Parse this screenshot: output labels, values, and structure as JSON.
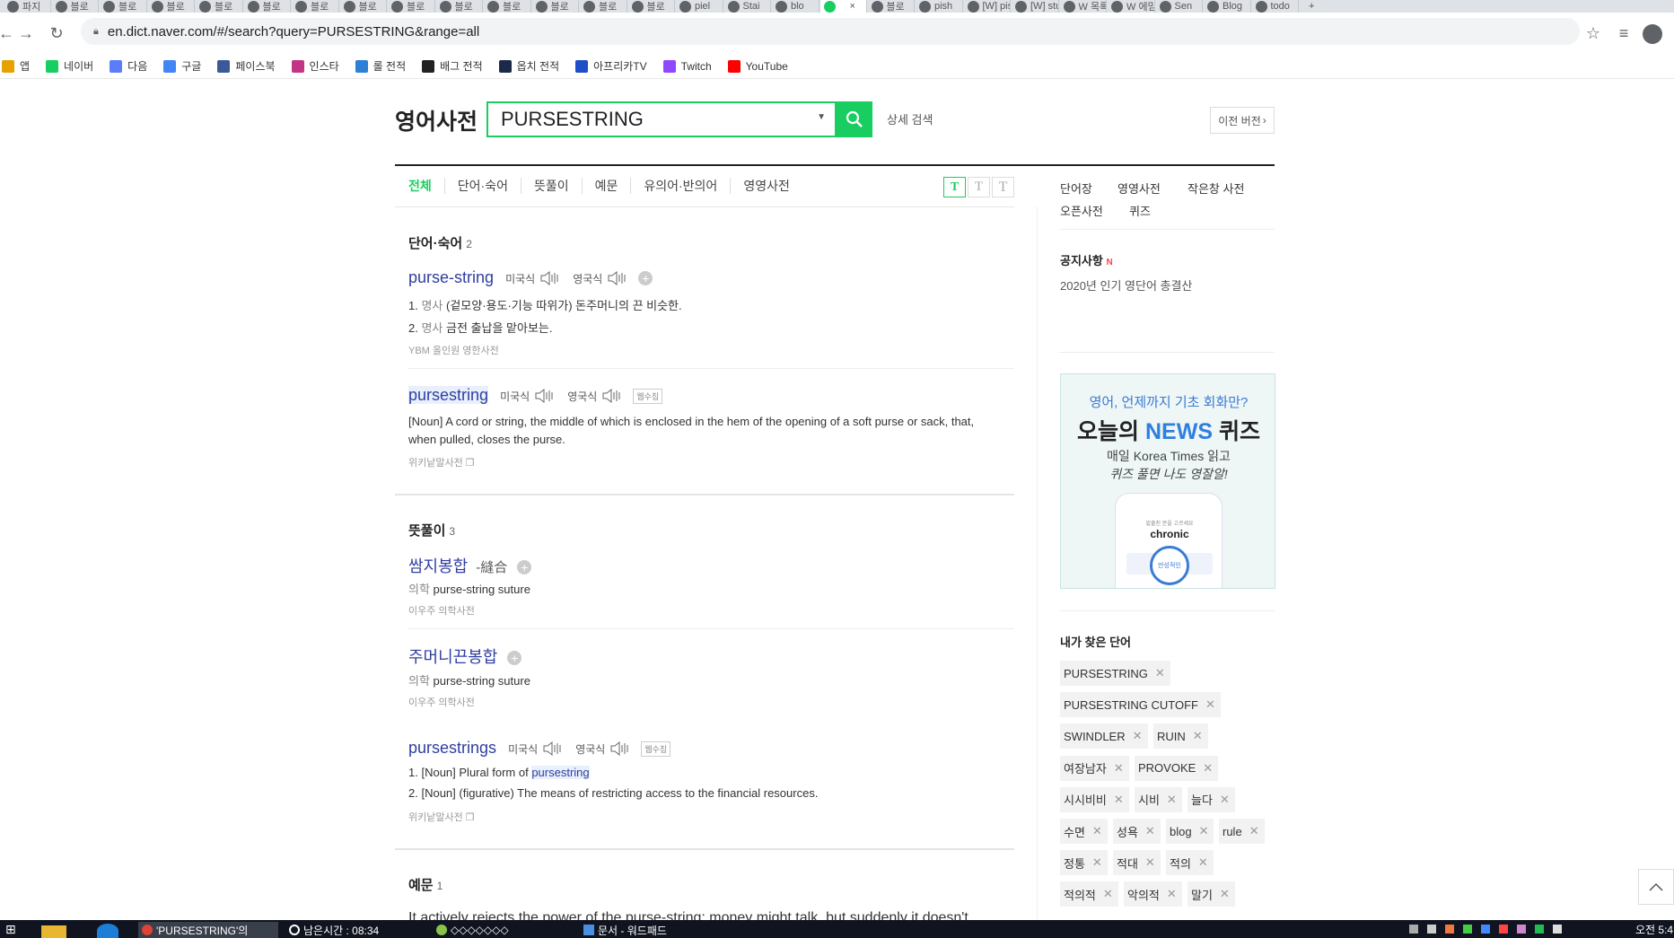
{
  "browser": {
    "tabs": [
      {
        "title": "파지",
        "active": false
      },
      {
        "title": "블로",
        "active": false
      },
      {
        "title": "블로",
        "active": false
      },
      {
        "title": "블로",
        "active": false
      },
      {
        "title": "블로",
        "active": false
      },
      {
        "title": "블로",
        "active": false
      },
      {
        "title": "블로",
        "active": false
      },
      {
        "title": "블로",
        "active": false
      },
      {
        "title": "블로",
        "active": false
      },
      {
        "title": "블로",
        "active": false
      },
      {
        "title": "블로",
        "active": false
      },
      {
        "title": "블로",
        "active": false
      },
      {
        "title": "블로",
        "active": false
      },
      {
        "title": "블로",
        "active": false
      },
      {
        "title": "piel",
        "active": false
      },
      {
        "title": "Stai",
        "active": false
      },
      {
        "title": "blo",
        "active": false
      },
      {
        "title": "",
        "active": true
      },
      {
        "title": "블로",
        "active": false
      },
      {
        "title": "pish",
        "active": false
      },
      {
        "title": "[W] pish",
        "active": false
      },
      {
        "title": "[W] stuc",
        "active": false
      },
      {
        "title": "W 목록",
        "active": false
      },
      {
        "title": "W 에믿",
        "active": false
      },
      {
        "title": "Sen",
        "active": false
      },
      {
        "title": "Blog",
        "active": false
      },
      {
        "title": "todo",
        "active": false
      }
    ],
    "url": "en.dict.naver.com/#/search?query=PURSESTRING&range=all",
    "bookmarks": [
      {
        "label": "앱",
        "color": "#e5a200"
      },
      {
        "label": "네이버",
        "color": "#19ce60"
      },
      {
        "label": "다음",
        "color": "#5b7dfa"
      },
      {
        "label": "구글",
        "color": "#4285f4"
      },
      {
        "label": "페이스북",
        "color": "#3b5998"
      },
      {
        "label": "인스타",
        "color": "#c13584"
      },
      {
        "label": "롤 전적",
        "color": "#2e7fd6"
      },
      {
        "label": "배그 전적",
        "color": "#222222"
      },
      {
        "label": "옵치 전적",
        "color": "#1b2a4a"
      },
      {
        "label": "아프리카TV",
        "color": "#1e4fc7"
      },
      {
        "label": "Twitch",
        "color": "#9146ff"
      },
      {
        "label": "YouTube",
        "color": "#ff0000"
      }
    ]
  },
  "dict": {
    "logo": "영어사전",
    "query": "PURSESTRING",
    "advanced": "상세 검색",
    "prev_version": "이전 버전",
    "tabs": [
      "전체",
      "단어·숙어",
      "뜻풀이",
      "예문",
      "유의어·반의어",
      "영영사전"
    ],
    "font_buttons": [
      "T",
      "T",
      "T"
    ],
    "words": {
      "heading": "단어·숙어",
      "count": "2",
      "items": [
        {
          "word": "purse-string",
          "us": "미국식",
          "uk": "영국식",
          "defs": [
            {
              "num": "1.",
              "pos": "명사",
              "text": "(겉모양·용도·기능 따위가) 돈주머니의 끈 비슷한."
            },
            {
              "num": "2.",
              "pos": "명사",
              "text": "금전 출납을 맡아보는."
            }
          ],
          "source": "YBM 올인원 영한사전"
        },
        {
          "word": "pursestring",
          "us": "미국식",
          "uk": "영국식",
          "badge": "웹수집",
          "def": "[Noun] A cord or string, the middle of which is enclosed in the hem of the opening of a soft purse or sack, that, when pulled, closes the purse.",
          "source": "위키낱말사전"
        }
      ]
    },
    "meanings": {
      "heading": "뜻풀이",
      "count": "3",
      "items": [
        {
          "word": "쌈지봉합",
          "hanja": "-縫合",
          "field": "의학",
          "text": "purse-string suture",
          "source": "이우주 의학사전"
        },
        {
          "word": "주머니끈봉합",
          "field": "의학",
          "text": "purse-string suture",
          "source": "이우주 의학사전"
        },
        {
          "word": "pursestrings",
          "us": "미국식",
          "uk": "영국식",
          "badge": "웹수집",
          "def1_num": "1.",
          "def1_text": "[Noun] Plural form of",
          "def1_link": "pursestring",
          "def2_num": "2.",
          "def2_text": "[Noun] (figurative) The means of restricting access to the financial resources.",
          "source": "위키낱말사전"
        }
      ]
    },
    "examples": {
      "heading": "예문",
      "count": "1",
      "first": "It actively rejects the power of the purse-string; money might talk, but suddenly it doesn't"
    }
  },
  "sidebar": {
    "links": [
      "단어장",
      "영영사전",
      "작은창 사전",
      "오픈사전",
      "퀴즈"
    ],
    "notice_title": "공지사항",
    "notice_new": "N",
    "notice_text": "2020년 인기 영단어 총결산",
    "banner": {
      "line1": "영어, 언제까지 기초 회화만?",
      "line2a": "오늘의",
      "line2b": "NEWS",
      "line2c": "퀴즈",
      "line3": "매일 Korea Times 읽고",
      "line4": "퀴즈 풀면 나도 영잘알!",
      "phone_small": "밑줄친 문을 고르세요",
      "phone_word": "chronic",
      "phone_answer": "만성적인"
    },
    "history_title": "내가 찾은 단어",
    "history": [
      [
        "PURSESTRING"
      ],
      [
        "PURSESTRING CUTOFF"
      ],
      [
        "SWINDLER",
        "RUIN"
      ],
      [
        "여장남자",
        "PROVOKE"
      ],
      [
        "시시비비",
        "시비",
        "늘다"
      ],
      [
        "수면",
        "성욕",
        "blog",
        "rule"
      ],
      [
        "정통",
        "적대",
        "적의"
      ],
      [
        "적의적",
        "악의적",
        "말기"
      ]
    ]
  },
  "taskbar": {
    "items": [
      "'PURSESTRING'의",
      "남은시간 : 08:34",
      "◇◇◇◇◇◇◇",
      "문서 - 워드패드"
    ],
    "clock": "오전 5:4"
  }
}
